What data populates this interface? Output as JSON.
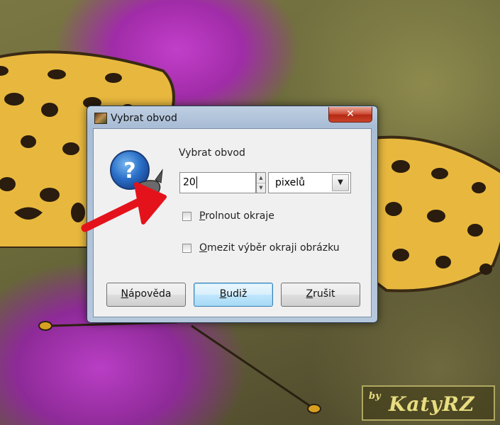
{
  "dialog": {
    "title": "Vybrat obvod",
    "close_glyph": "✕",
    "heading": "Vybrat obvod",
    "icon": "gimp-question-icon",
    "size_value": "20",
    "unit_value": "pixelů",
    "feather_label": "Prolnout okraje",
    "feather_mnemonic": "P",
    "feather_rest": "rolnout okraje",
    "feather_checked": false,
    "clamp_label": "Omezit výběr okraji obrázku",
    "clamp_mnemonic": "O",
    "clamp_rest": "mezit výběr okraji obrázku",
    "clamp_checked": false,
    "buttons": {
      "help_mnemonic": "N",
      "help_rest": "ápověda",
      "ok_mnemonic": "B",
      "ok_rest": "udiž",
      "cancel_mnemonic": "Z",
      "cancel_rest": "rušit"
    }
  },
  "watermark": {
    "by": "by",
    "signature": "KatyRZ"
  },
  "colors": {
    "arrow": "#e4131b",
    "accent": "#3c7fb1",
    "close_button": "#c8442a"
  }
}
